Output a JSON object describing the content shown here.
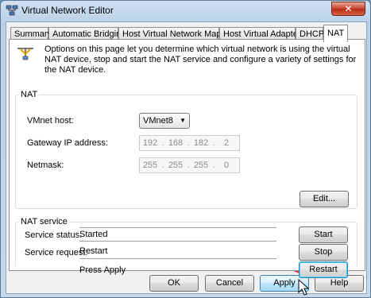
{
  "window": {
    "title": "Virtual Network Editor",
    "close_label": "✕"
  },
  "tabs": [
    {
      "label": "Summary",
      "active": false
    },
    {
      "label": "Automatic Bridging",
      "active": false
    },
    {
      "label": "Host Virtual Network Mapping",
      "active": false
    },
    {
      "label": "Host Virtual Adapters",
      "active": false
    },
    {
      "label": "DHCP",
      "active": false
    },
    {
      "label": "NAT",
      "active": true
    }
  ],
  "info": {
    "text": "Options on this page let you determine which virtual network is using the virtual NAT device, stop and start the NAT service and configure a variety of settings for the NAT device.",
    "icon": "network-icon"
  },
  "nat": {
    "legend": "NAT",
    "vmnet_host_label": "VMnet host:",
    "vmnet_host_value": "VMnet8",
    "gateway_label": "Gateway IP address:",
    "gateway_octets": [
      "192",
      "168",
      "182",
      "2"
    ],
    "netmask_label": "Netmask:",
    "netmask_octets": [
      "255",
      "255",
      "255",
      "0"
    ],
    "edit_button": "Edit..."
  },
  "nat_service": {
    "legend": "NAT service",
    "status_label": "Service status:",
    "status_value": "Started",
    "request_label": "Service request:",
    "request_value": "Restart",
    "hint": "Press Apply",
    "start_button": "Start",
    "stop_button": "Stop",
    "restart_button": "Restart"
  },
  "dialog_buttons": {
    "ok": "OK",
    "cancel": "Cancel",
    "apply": "Apply",
    "help": "Help"
  },
  "colors": {
    "annotation": "#e0322f",
    "focus_border": "#3c7fb1"
  }
}
